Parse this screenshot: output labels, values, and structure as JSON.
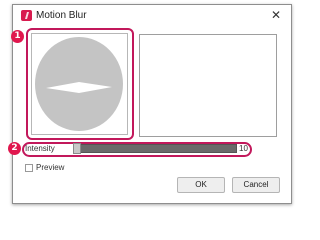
{
  "window": {
    "title": "Motion Blur",
    "icon": "app-logo-icon",
    "close_icon": "close-icon",
    "close_glyph": "✕",
    "accent_color": "#c2185b"
  },
  "annotations": {
    "badge_1": "1",
    "badge_2": "2"
  },
  "slider": {
    "label": "Intensity",
    "value": "10",
    "fill_fraction": 0.0
  },
  "preview_checkbox": {
    "label": "Preview",
    "checked": false
  },
  "buttons": {
    "ok": "OK",
    "cancel": "Cancel"
  }
}
